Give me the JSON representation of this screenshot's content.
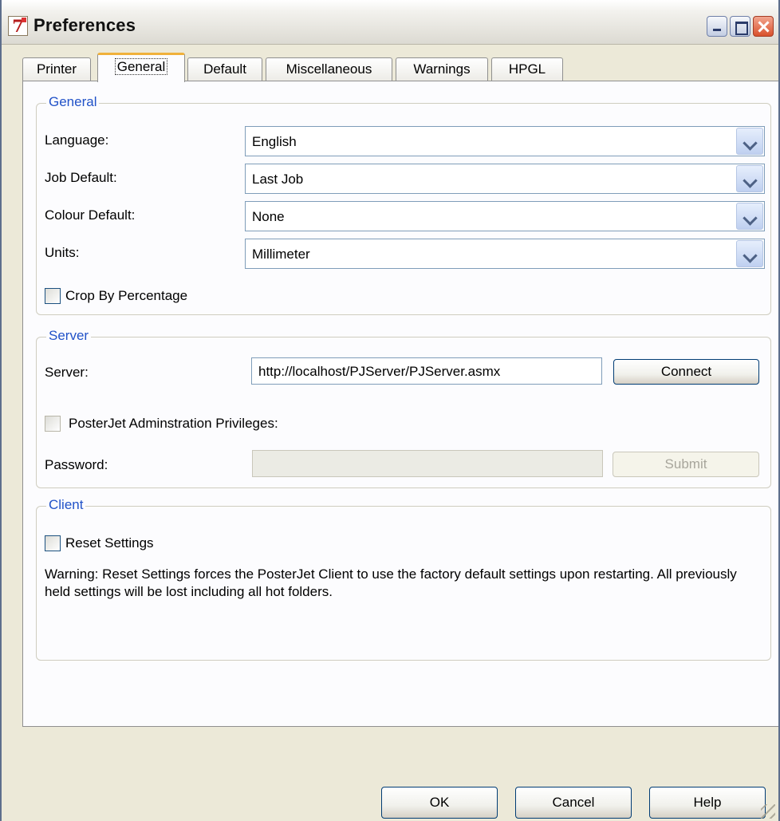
{
  "window": {
    "title": "Preferences",
    "icon": "app-icon-7"
  },
  "tabs": [
    {
      "label": "Printer",
      "active": false
    },
    {
      "label": "General",
      "active": true
    },
    {
      "label": "Default",
      "active": false
    },
    {
      "label": "Miscellaneous",
      "active": false
    },
    {
      "label": "Warnings",
      "active": false
    },
    {
      "label": "HPGL",
      "active": false
    }
  ],
  "general": {
    "legend": "General",
    "language_label": "Language:",
    "language_value": "English",
    "job_default_label": "Job Default:",
    "job_default_value": "Last Job",
    "colour_default_label": "Colour Default:",
    "colour_default_value": "None",
    "units_label": "Units:",
    "units_value": "Millimeter",
    "crop_label": "Crop By Percentage",
    "crop_checked": false
  },
  "server": {
    "legend": "Server",
    "server_label": "Server:",
    "server_value": "http://localhost/PJServer/PJServer.asmx",
    "connect_label": "Connect",
    "admin_label": "PosterJet Adminstration Privileges:",
    "admin_checked": false,
    "password_label": "Password:",
    "password_value": "",
    "submit_label": "Submit"
  },
  "client": {
    "legend": "Client",
    "reset_label": "Reset Settings",
    "reset_checked": false,
    "warning_text": "Warning: Reset Settings forces the PosterJet Client to use the factory default settings upon restarting.  All previously held settings will be lost including all hot folders."
  },
  "footer": {
    "ok_label": "OK",
    "cancel_label": "Cancel",
    "help_label": "Help"
  },
  "colors": {
    "accent_legend": "#2152c8",
    "tab_highlight": "#f0b13b"
  }
}
